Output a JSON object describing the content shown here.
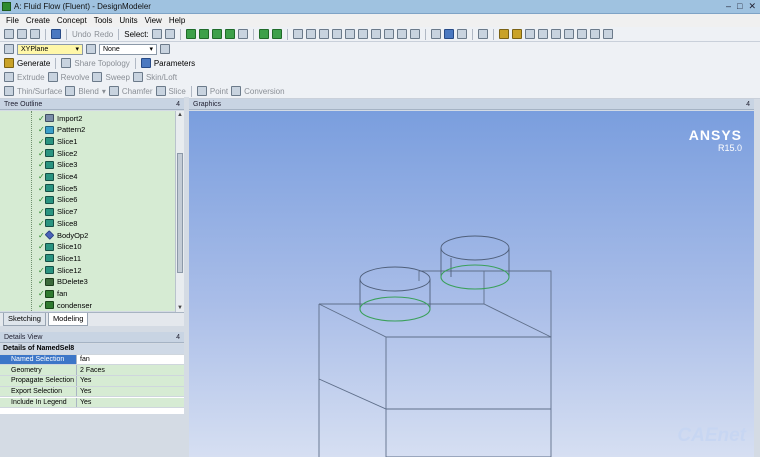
{
  "window": {
    "title": "A: Fluid Flow (Fluent) - DesignModeler"
  },
  "menu": [
    "File",
    "Create",
    "Concept",
    "Tools",
    "Units",
    "View",
    "Help"
  ],
  "toolbar1": {
    "undo_label": "Undo",
    "redo_label": "Redo",
    "select_label": "Select:"
  },
  "toolbar2": {
    "plane": "XYPlane",
    "sketch": "None"
  },
  "toolbar3": {
    "generate": "Generate",
    "share_topology": "Share Topology",
    "parameters": "Parameters"
  },
  "toolbar4": {
    "extrude": "Extrude",
    "revolve": "Revolve",
    "sweep": "Sweep",
    "skin_loft": "Skin/Loft"
  },
  "toolbar5": {
    "thin_surface": "Thin/Surface",
    "blend": "Blend",
    "chamfer": "Chamfer",
    "slice": "Slice",
    "point": "Point",
    "conversion": "Conversion"
  },
  "tree": {
    "title": "Tree Outline",
    "pin": "4",
    "items": [
      {
        "label": "Import2",
        "icon": "import"
      },
      {
        "label": "Pattern2",
        "icon": "pattern"
      },
      {
        "label": "Slice1",
        "icon": "slice"
      },
      {
        "label": "Slice2",
        "icon": "slice"
      },
      {
        "label": "Slice3",
        "icon": "slice"
      },
      {
        "label": "Slice4",
        "icon": "slice"
      },
      {
        "label": "Slice5",
        "icon": "slice"
      },
      {
        "label": "Slice6",
        "icon": "slice"
      },
      {
        "label": "Slice7",
        "icon": "slice"
      },
      {
        "label": "Slice8",
        "icon": "slice"
      },
      {
        "label": "BodyOp2",
        "icon": "bodyop"
      },
      {
        "label": "Slice10",
        "icon": "slice"
      },
      {
        "label": "Slice11",
        "icon": "slice"
      },
      {
        "label": "Slice12",
        "icon": "slice"
      },
      {
        "label": "BDelete3",
        "icon": "bdelete"
      },
      {
        "label": "fan",
        "icon": "named-selection"
      },
      {
        "label": "condenser",
        "icon": "named-selection"
      }
    ]
  },
  "tabs": {
    "sketching": "Sketching",
    "modeling": "Modeling"
  },
  "details": {
    "title": "Details View",
    "pin": "4",
    "header": "Details of NamedSel8",
    "rows": [
      {
        "key": "Named Selection",
        "value": "fan"
      },
      {
        "key": "Geometry",
        "value": "2 Faces"
      },
      {
        "key": "Propagate Selection",
        "value": "Yes"
      },
      {
        "key": "Export Selection",
        "value": "Yes"
      },
      {
        "key": "Include In Legend",
        "value": "Yes"
      }
    ]
  },
  "graphics": {
    "title": "Graphics",
    "pin": "4",
    "brand": "ANSYS",
    "version": "R15.0",
    "watermark": "CAEnet"
  }
}
